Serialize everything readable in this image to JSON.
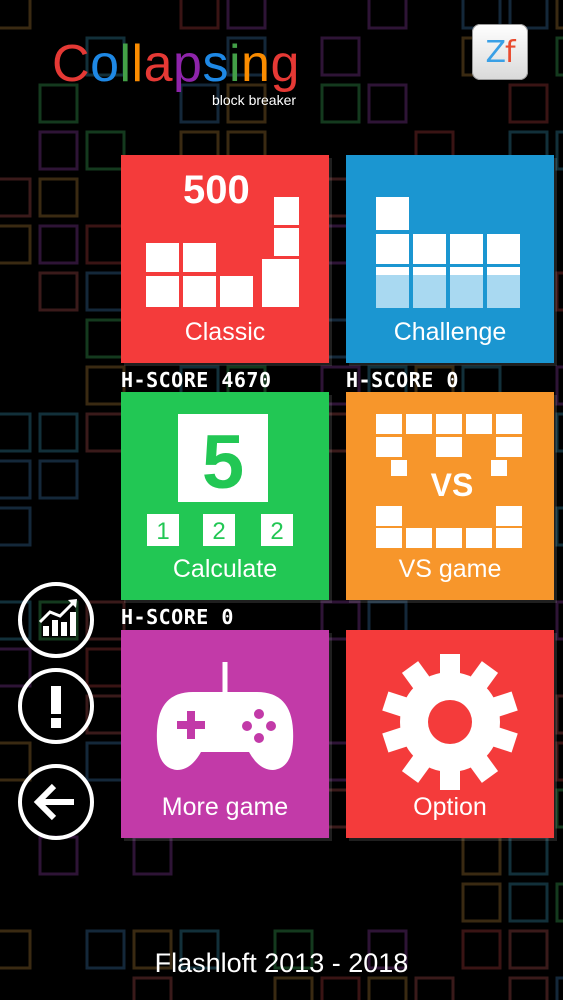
{
  "logo": {
    "title": "Collapsing",
    "title_colors": [
      "#e53935",
      "#1e88e5",
      "#43a047",
      "#fb8c00",
      "#e53935",
      "#8e24aa",
      "#1e88e5",
      "#43a047",
      "#fb8c00",
      "#e53935"
    ],
    "subtitle": "block breaker"
  },
  "zf_button": {
    "z": "Z",
    "f": "f"
  },
  "tiles": {
    "classic": {
      "label": "Classic",
      "number": "500",
      "color": "#f43b3b",
      "hscore": "H-SCORE 4670"
    },
    "challenge": {
      "label": "Challenge",
      "color": "#1b96d1",
      "hscore": "H-SCORE 0"
    },
    "calculate": {
      "label": "Calculate",
      "big_number": "5",
      "small_numbers": [
        "1",
        "2",
        "2"
      ],
      "color": "#22c754",
      "hscore": "H-SCORE 0"
    },
    "vs_game": {
      "label": "VS game",
      "vs_text": "VS",
      "color": "#f7962b"
    },
    "more_game": {
      "label": "More game",
      "color": "#c23aa8"
    },
    "option": {
      "label": "Option",
      "color": "#f43b3b"
    }
  },
  "side_buttons": {
    "stats_icon": "bar-chart-trend-icon",
    "info_icon": "exclamation-icon",
    "back_icon": "back-arrow-icon"
  },
  "footer": {
    "text": "Flashloft 2013 - 2018"
  }
}
